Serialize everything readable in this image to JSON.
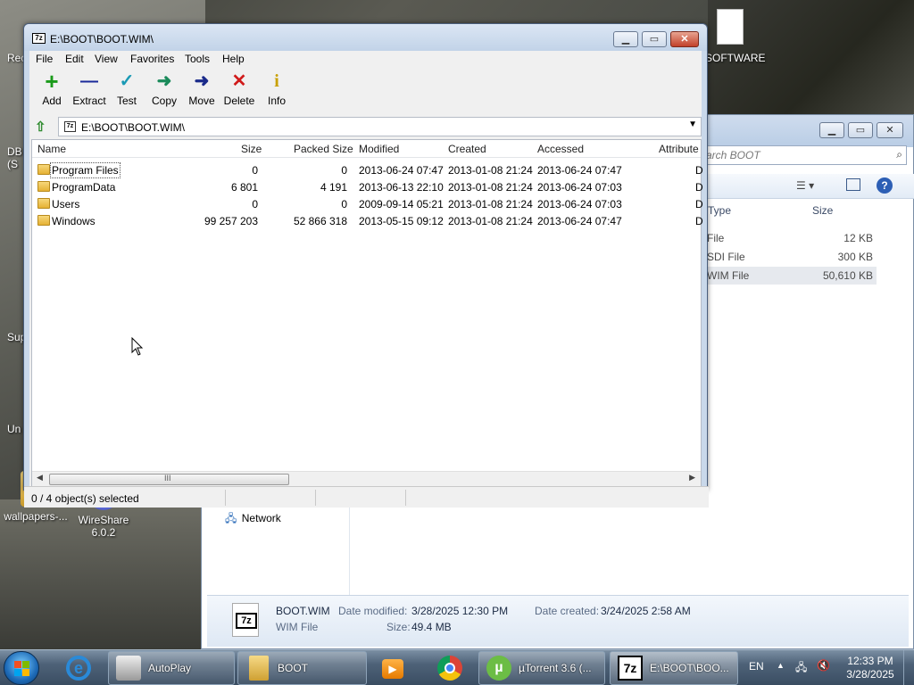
{
  "desktop": {
    "icons": [
      {
        "label": "wallpapers-..."
      },
      {
        "label": "WireShare 6.0.2"
      }
    ],
    "partial_labels": [
      "Rec",
      "DB",
      "(S",
      "Sup",
      "Un",
      "SOFTWARE"
    ]
  },
  "explorer": {
    "search_placeholder": "arch BOOT",
    "columns": {
      "type": "Type",
      "size": "Size"
    },
    "rows": [
      {
        "type": "File",
        "size": "12 KB"
      },
      {
        "type": "SDI File",
        "size": "300 KB"
      },
      {
        "type": "WIM File",
        "size": "50,610 KB"
      }
    ],
    "nav_network": "Network",
    "details": {
      "filename": "BOOT.WIM",
      "filetype": "WIM File",
      "date_modified_label": "Date modified:",
      "date_modified": "3/28/2025 12:30 PM",
      "date_created_label": "Date created:",
      "date_created": "3/24/2025 2:58 AM",
      "size_label": "Size:",
      "size": "49.4 MB",
      "icon_text": "7z"
    }
  },
  "zip": {
    "title": "E:\\BOOT\\BOOT.WIM\\",
    "app_icon": "7z",
    "menu": [
      "File",
      "Edit",
      "View",
      "Favorites",
      "Tools",
      "Help"
    ],
    "toolbar": [
      {
        "label": "Add",
        "icon": "plus-icon",
        "glyph": "+",
        "color": "#1a9a1a"
      },
      {
        "label": "Extract",
        "icon": "minus-icon",
        "glyph": "—",
        "color": "#1a2a9a"
      },
      {
        "label": "Test",
        "icon": "check-icon",
        "glyph": "✓",
        "color": "#1a9ab5"
      },
      {
        "label": "Copy",
        "icon": "arrow-right-icon",
        "glyph": "➜",
        "color": "#1a8a5a"
      },
      {
        "label": "Move",
        "icon": "arrow-right-icon",
        "glyph": "➜",
        "color": "#1a2a8a"
      },
      {
        "label": "Delete",
        "icon": "x-icon",
        "glyph": "✕",
        "color": "#d01a1a"
      },
      {
        "label": "Info",
        "icon": "info-icon",
        "glyph": "i",
        "color": "#c8a000"
      }
    ],
    "path": "E:\\BOOT\\BOOT.WIM\\",
    "columns": {
      "name": "Name",
      "size": "Size",
      "packed": "Packed Size",
      "modified": "Modified",
      "created": "Created",
      "accessed": "Accessed",
      "attributes": "Attribute"
    },
    "rows": [
      {
        "name": "Program Files",
        "size": "0",
        "packed": "0",
        "modified": "2013-06-24 07:47",
        "created": "2013-01-08 21:24",
        "accessed": "2013-06-24 07:47",
        "attr": "D"
      },
      {
        "name": "ProgramData",
        "size": "6 801",
        "packed": "4 191",
        "modified": "2013-06-13 22:10",
        "created": "2013-01-08 21:24",
        "accessed": "2013-06-24 07:03",
        "attr": "D"
      },
      {
        "name": "Users",
        "size": "0",
        "packed": "0",
        "modified": "2009-09-14 05:21",
        "created": "2013-01-08 21:24",
        "accessed": "2013-06-24 07:03",
        "attr": "D"
      },
      {
        "name": "Windows",
        "size": "99 257 203",
        "packed": "52 866 318",
        "modified": "2013-05-15 09:12",
        "created": "2013-01-08 21:24",
        "accessed": "2013-06-24 07:47",
        "attr": "D"
      }
    ],
    "status": "0 / 4 object(s) selected",
    "scroll_grip": "III"
  },
  "taskbar": {
    "items": [
      {
        "label": "AutoPlay"
      },
      {
        "label": "BOOT"
      },
      {
        "label": "µTorrent 3.6  (..."
      },
      {
        "label": "E:\\BOOT\\BOO..."
      }
    ],
    "lang": "EN",
    "time": "12:33 PM",
    "date": "3/28/2025"
  }
}
